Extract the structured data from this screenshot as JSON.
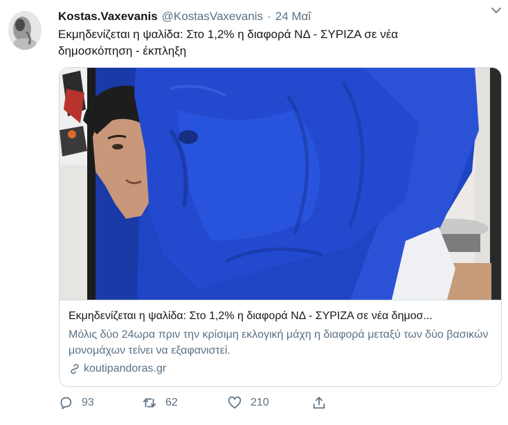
{
  "tweet": {
    "author_name": "Kostas.Vaxevanis",
    "handle": "@KostasVaxevanis",
    "separator": "·",
    "date": "24 Μαΐ",
    "text": "Εκμηδενίζεται η ψαλίδα: Στο 1,2% η διαφορά ΝΔ - ΣΥΡΙΖΑ σε νέα δημοσκόπηση - έκπληξη"
  },
  "card": {
    "title": "Εκμηδενίζεται η ψαλίδα: Στο 1,2% η διαφορά ΝΔ - ΣΥΡΙΖΑ σε νέα δημοσ...",
    "description": "Μόλις δύο 24ωρα πριν την κρίσιμη εκλογική μάχη η διαφορά μεταξύ των δύο βασικών μονομάχων τείνει να εξαφανιστεί.",
    "domain": "koutipandoras.gr"
  },
  "actions": {
    "replies": "93",
    "retweets": "62",
    "likes": "210"
  },
  "icons": {
    "caret": "chevron-down-icon",
    "reply": "reply-icon",
    "retweet": "retweet-icon",
    "like": "heart-icon",
    "share": "share-icon",
    "link": "link-icon"
  },
  "colors": {
    "text": "#14171a",
    "secondary": "#5b7083",
    "border": "#cfd9de",
    "curtain_blue": "#1f44c4"
  }
}
